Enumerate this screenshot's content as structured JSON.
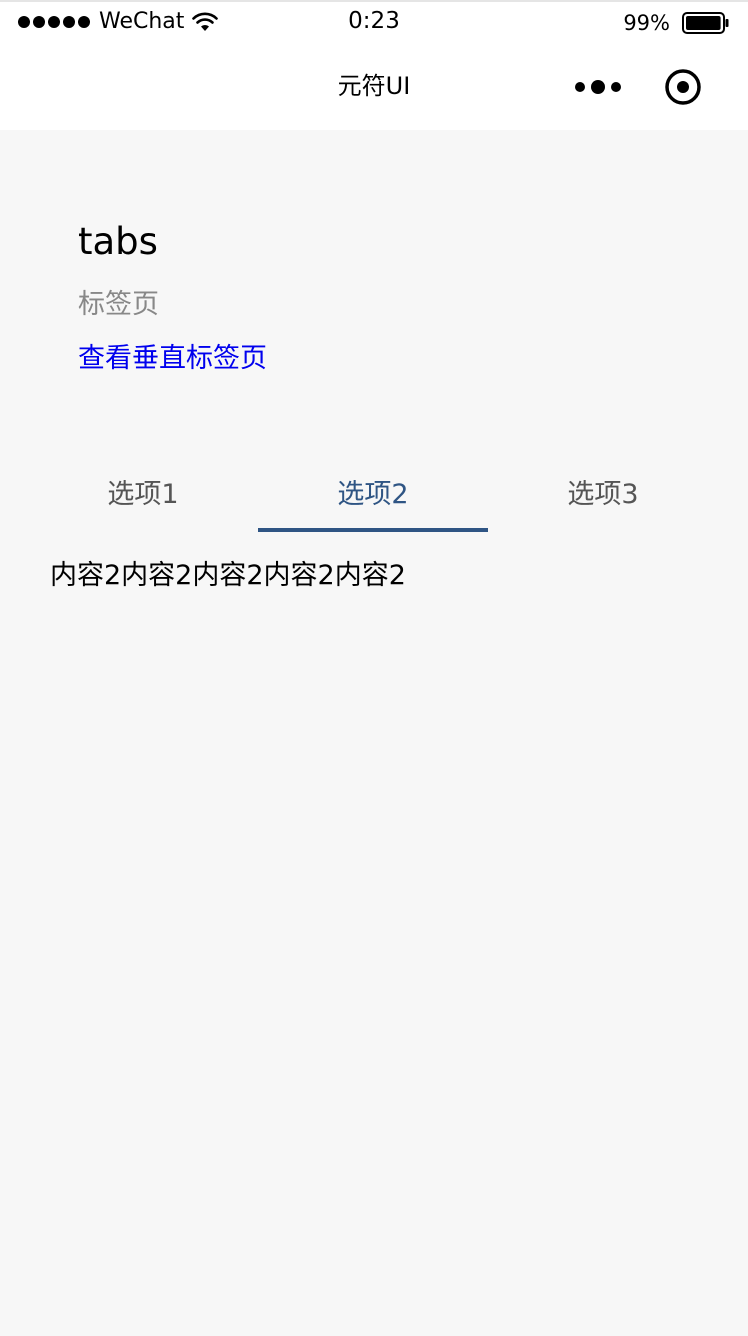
{
  "status_bar": {
    "signal_icon": "signal-dots-icon",
    "carrier": "WeChat",
    "wifi_icon": "wifi-icon",
    "time": "0:23",
    "battery_percent": "99%",
    "battery_level": 0.99,
    "battery_icon": "battery-icon"
  },
  "nav_bar": {
    "title": "元符UI",
    "more_icon": "more-dots-icon",
    "close_icon": "target-circle-icon"
  },
  "header": {
    "title": "tabs",
    "description": "标签页",
    "link_text": "查看垂直标签页"
  },
  "tabs": {
    "items": [
      {
        "label": "选项1",
        "active": false
      },
      {
        "label": "选项2",
        "active": true
      },
      {
        "label": "选项3",
        "active": false
      }
    ],
    "content": "内容2内容2内容2内容2内容2"
  },
  "colors": {
    "active_tab": "#2f5584",
    "link": "#0000ee",
    "muted_text": "#888888",
    "background": "#f7f7f7"
  }
}
